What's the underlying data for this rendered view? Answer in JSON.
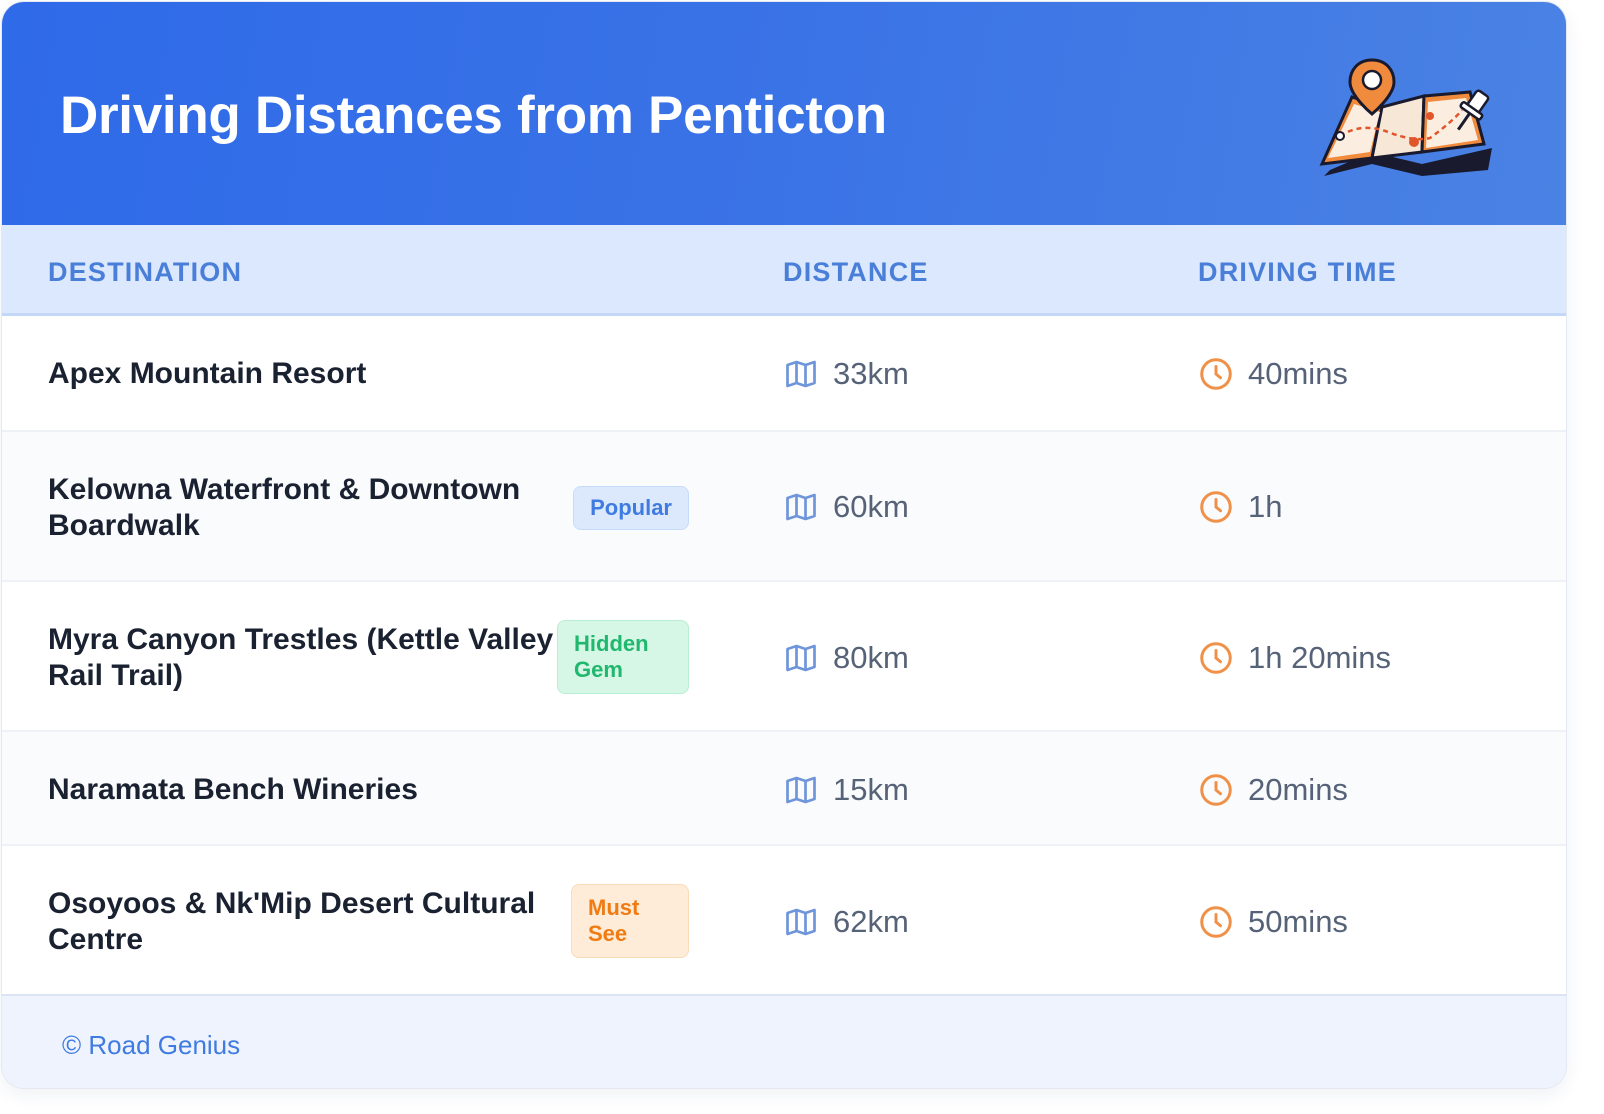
{
  "header": {
    "title": "Driving Distances from Penticton",
    "illustration": "map-pin-icon"
  },
  "table": {
    "columns": [
      "DESTINATION",
      "DISTANCE",
      "DRIVING TIME"
    ],
    "rows": [
      {
        "destination": "Apex Mountain Resort",
        "badge": "",
        "distance": "33km",
        "time": "40mins"
      },
      {
        "destination": "Kelowna Waterfront & Downtown Boardwalk",
        "badge": "Popular",
        "badge_color": "#3f7be0",
        "distance": "60km",
        "time": "1h"
      },
      {
        "destination": "Myra Canyon Trestles (Kettle Valley Rail Trail)",
        "badge": "Hidden Gem",
        "badge_color": "#1fb86e",
        "distance": "80km",
        "time": "1h 20mins"
      },
      {
        "destination": "Naramata Bench Wineries",
        "badge": "",
        "distance": "15km",
        "time": "20mins"
      },
      {
        "destination": "Osoyoos & Nk'Mip Desert Cultural Centre",
        "badge": "Must See",
        "badge_color": "#f07b12",
        "distance": "62km",
        "time": "50mins"
      }
    ],
    "distance_icon": "map-icon",
    "time_icon": "clock-icon"
  },
  "footer": {
    "text": "© Road Genius"
  },
  "colors": {
    "header_start": "#2f6ae9",
    "header_end": "#4a82e4",
    "accent": "#3f7be0",
    "clock": "#f0914a",
    "map_icon": "#6f95da"
  }
}
